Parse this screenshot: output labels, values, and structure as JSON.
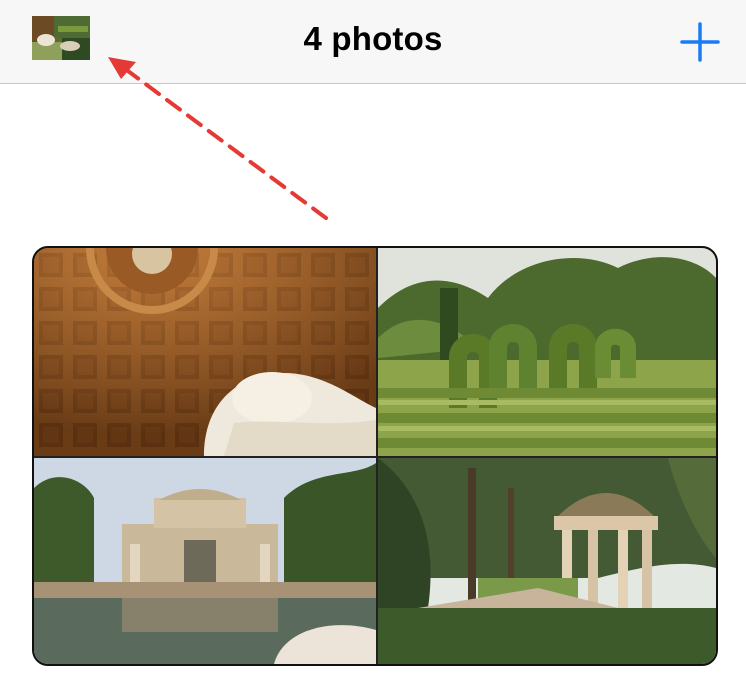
{
  "header": {
    "title": "4 photos",
    "add_icon": "plus-icon",
    "thumbnail_icon": "album-thumbnail"
  },
  "annotation": {
    "arrow_color": "#e53935"
  },
  "colors": {
    "accent": "#1a7cf5",
    "navbar_bg": "#f7f7f7"
  },
  "photos": [
    {
      "subject": "dome-ceiling-with-statue"
    },
    {
      "subject": "hedge-maze"
    },
    {
      "subject": "pavilion-with-pond"
    },
    {
      "subject": "temple-gazebo-in-garden"
    }
  ]
}
